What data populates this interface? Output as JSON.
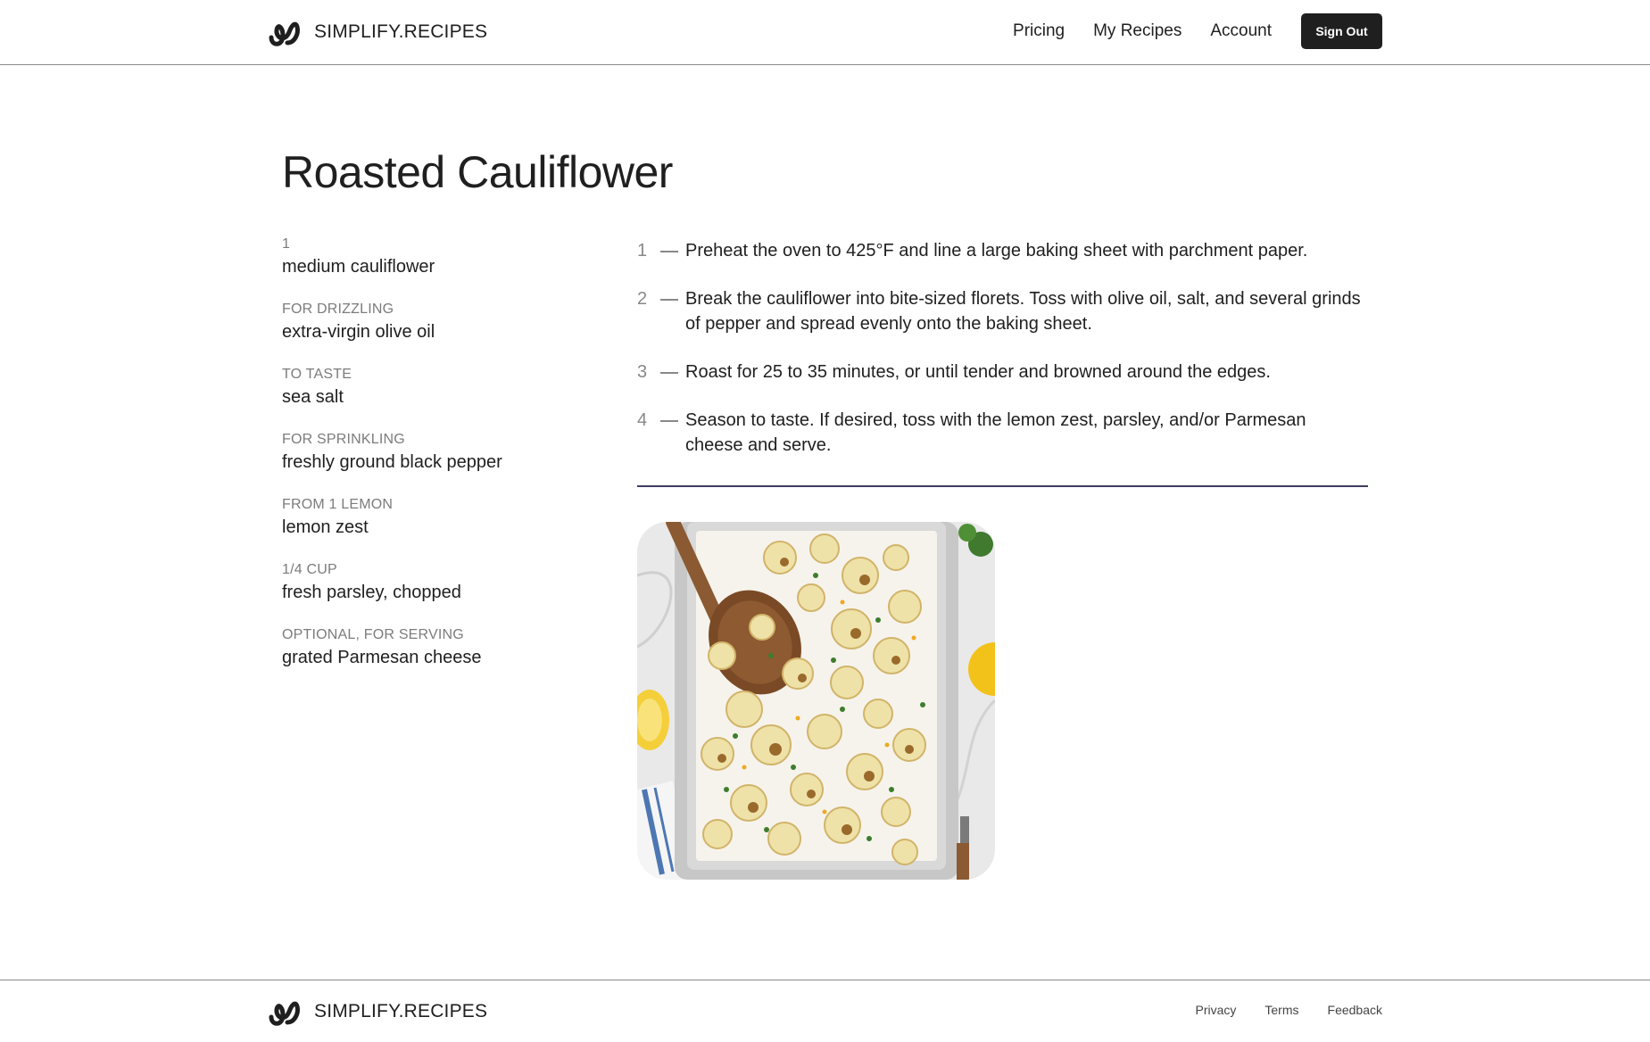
{
  "header": {
    "brand": "SIMPLIFY.RECIPES",
    "logo_icon": "squiggle-logo-icon",
    "nav": [
      {
        "label": "Pricing"
      },
      {
        "label": "My Recipes"
      },
      {
        "label": "Account"
      }
    ],
    "sign_out_label": "Sign Out"
  },
  "recipe": {
    "title": "Roasted Cauliflower",
    "ingredients": [
      {
        "qty": "1",
        "name": "medium cauliflower"
      },
      {
        "qty": "FOR DRIZZLING",
        "name": "extra-virgin olive oil"
      },
      {
        "qty": "TO TASTE",
        "name": "sea salt"
      },
      {
        "qty": "FOR SPRINKLING",
        "name": "freshly ground black pepper"
      },
      {
        "qty": "FROM 1 LEMON",
        "name": "lemon zest"
      },
      {
        "qty": "1/4 CUP",
        "name": "fresh parsley, chopped"
      },
      {
        "qty": "OPTIONAL, FOR SERVING",
        "name": "grated Parmesan cheese"
      }
    ],
    "steps": [
      {
        "num": "1",
        "text": "Preheat the oven to 425°F and line a large baking sheet with parchment paper."
      },
      {
        "num": "2",
        "text": "Break the cauliflower into bite-sized florets. Toss with olive oil, salt, and several grinds of pepper and spread evenly onto the baking sheet."
      },
      {
        "num": "3",
        "text": "Roast for 25 to 35 minutes, or until tender and browned around the edges."
      },
      {
        "num": "4",
        "text": "Season to taste. If desired, toss with the lemon zest, parsley, and/or Parmesan cheese and serve."
      }
    ]
  },
  "footer": {
    "brand": "SIMPLIFY.RECIPES",
    "links": [
      {
        "label": "Privacy"
      },
      {
        "label": "Terms"
      },
      {
        "label": "Feedback"
      }
    ]
  },
  "colors": {
    "text": "#1f1f1f",
    "muted": "#7c7c7c",
    "button_bg": "#1f1f1f",
    "divider": "#3e3e62"
  }
}
